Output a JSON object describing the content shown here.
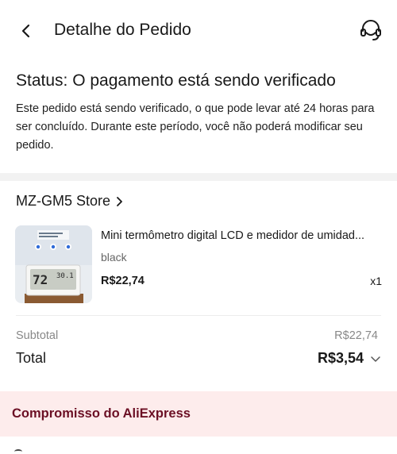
{
  "header": {
    "title": "Detalhe do Pedido",
    "back_icon": "chevron-left-icon",
    "support_icon": "headset-support-icon"
  },
  "status": {
    "title": "Status: O pagamento está sendo verificado",
    "description": "Este pedido está sendo verificado, o que pode levar até 24 horas para ser concluído. Durante este período, você não poderá modificar seu pedido."
  },
  "store": {
    "name": "MZ-GM5 Store",
    "chevron_icon": "chevron-right-icon"
  },
  "product": {
    "name": "Mini termômetro digital LCD e medidor de umidad...",
    "variant": "black",
    "price": "R$22,74",
    "quantity": "x1",
    "thumbnail_reading_temp": "72",
    "thumbnail_reading_hum": "30.1"
  },
  "summary": {
    "subtotal_label": "Subtotal",
    "subtotal_value": "R$22,74",
    "total_label": "Total",
    "total_value": "R$3,54",
    "expand_icon": "chevron-down-icon"
  },
  "commitment": {
    "title": "Compromisso do AliExpress"
  },
  "colors": {
    "commitment_bg": "#fdecec",
    "commitment_text": "#6b0f24",
    "divider": "#f2f2f2"
  }
}
